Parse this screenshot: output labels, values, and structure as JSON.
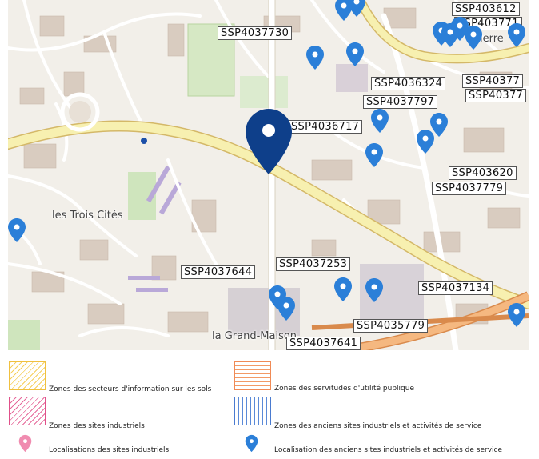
{
  "map": {
    "place_labels": [
      "les Trois Cités",
      "la Grand-Maison"
    ],
    "site_labels": [
      "SSP4037730",
      "SSP403612",
      "SSP403771",
      "SSP4036324",
      "SSP40377",
      "SSP40377",
      "SSP4037797",
      "SSP4036717",
      "SSP403620",
      "SSP4037779",
      "SSP4037644",
      "SSP4037253",
      "SSP4037134",
      "SSP4035779",
      "SSP4037641"
    ],
    "partial_label": "ierre",
    "selected_marker": "selected-site-marker",
    "marker_icon": "map-pin-icon",
    "colors": {
      "marker_blue": "#2b7fd8",
      "marker_selected": "#0e3f8a",
      "marker_pink": "#f08cb0"
    }
  },
  "legend": {
    "items": [
      {
        "label": "Zones des secteurs d'information sur les sols",
        "icon": "yellow-hatch-swatch"
      },
      {
        "label": "Zones des servitudes d'utilité publique",
        "icon": "orange-hatch-swatch"
      },
      {
        "label": "Zones des sites industriels",
        "icon": "pink-hatch-swatch"
      },
      {
        "label": "Zones des anciens sites industriels et activités de service",
        "icon": "blue-hatch-swatch"
      },
      {
        "label": "Localisations des sites industriels",
        "icon": "pink-pin-icon"
      },
      {
        "label": "Localisation des anciens sites industriels et activités de service",
        "icon": "blue-pin-icon"
      }
    ]
  }
}
